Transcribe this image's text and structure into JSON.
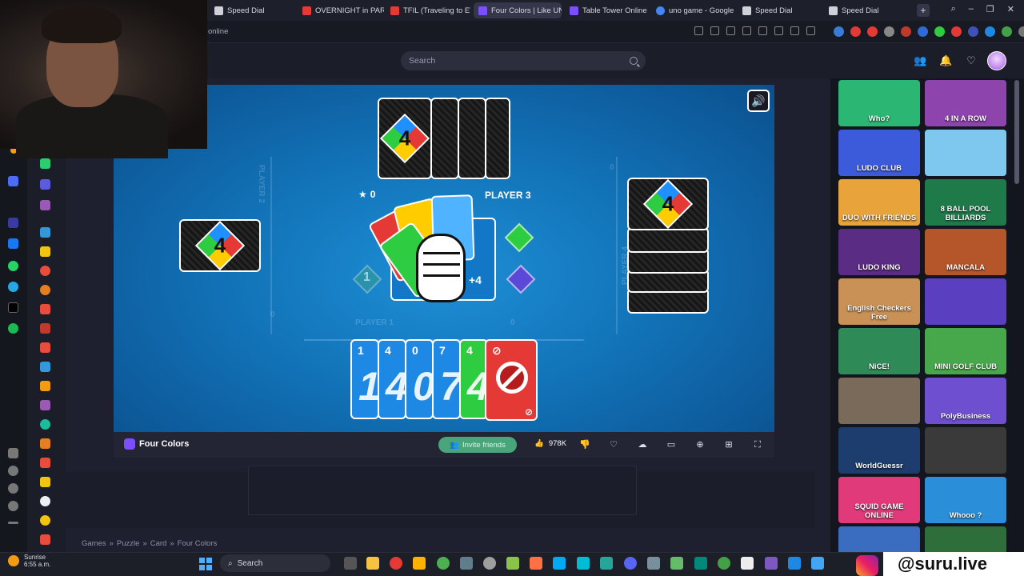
{
  "tabs": [
    {
      "label": "Speed Dial",
      "color": "#d0d0d8"
    },
    {
      "label": "OVERNIGHT in PARIS CA",
      "color": "#e53935"
    },
    {
      "label": "TFIL (Traveling to EVERY",
      "color": "#e53935"
    },
    {
      "label": "Four Colors | Like UNO",
      "color": "#7b4fff"
    },
    {
      "label": "Table Tower Online",
      "color": "#7b4fff"
    },
    {
      "label": "uno game - Google Sear",
      "color": "#4285f4"
    },
    {
      "label": "Speed Dial",
      "color": "#d0d0d8"
    },
    {
      "label": "Speed Dial",
      "color": "#d0d0d8"
    }
  ],
  "address": {
    "url_fragment": "online"
  },
  "site": {
    "search_placeholder": "Search"
  },
  "game": {
    "title": "Four Colors",
    "players": {
      "p1": {
        "label": "PLAYER 1",
        "score": "0"
      },
      "p2": {
        "label": "PLAYER 2",
        "score": "0"
      },
      "p3": {
        "label": "PLAYER 3",
        "score": "0"
      },
      "p4": {
        "label": "PLAYER 4",
        "score": "0"
      }
    },
    "top_cards_count": 5,
    "right_cards_count": 6,
    "hand": [
      {
        "value": "1",
        "color": "#1e88e5"
      },
      {
        "value": "4",
        "color": "#1e88e5"
      },
      {
        "value": "0",
        "color": "#1e88e5"
      },
      {
        "value": "7",
        "color": "#1e88e5"
      },
      {
        "value": "4",
        "color": "#2ecc40"
      },
      {
        "value": "⊘",
        "color": "#e53935"
      }
    ],
    "pile_top": "+4",
    "left_gem": "1"
  },
  "gamebar": {
    "invite_label": "Invite friends",
    "likes": "978K"
  },
  "breadcrumb": [
    "Games",
    "»",
    "Puzzle",
    "»",
    "Card",
    "»",
    "Four Colors"
  ],
  "thumbnails": [
    {
      "label": "Who?",
      "bg": "#2bb673"
    },
    {
      "label": "4 IN A ROW",
      "bg": "#8e44ad"
    },
    {
      "label": "LUDO CLUB",
      "bg": "#3b5bdb"
    },
    {
      "label": "",
      "bg": "#7ec8f0"
    },
    {
      "label": "DUO WITH FRIENDS",
      "bg": "#e8a33a"
    },
    {
      "label": "8 BALL POOL BILLIARDS",
      "bg": "#1f7a4a"
    },
    {
      "label": "LUDO KING",
      "bg": "#5b2c83"
    },
    {
      "label": "MANCALA",
      "bg": "#b5562a"
    },
    {
      "label": "English Checkers Free",
      "bg": "#c99155"
    },
    {
      "label": "",
      "bg": "#5a3fc0"
    },
    {
      "label": "NiCE!",
      "bg": "#2e8b57"
    },
    {
      "label": "MINI GOLF CLUB",
      "bg": "#46a84a"
    },
    {
      "label": "",
      "bg": "#7a6a5a"
    },
    {
      "label": "PolyBusiness",
      "bg": "#6e4fd0"
    },
    {
      "label": "WorldGuessr",
      "bg": "#1c3d6e"
    },
    {
      "label": "",
      "bg": "#3a3a3a"
    },
    {
      "label": "SQUID GAME ONLINE",
      "bg": "#e03a7a"
    },
    {
      "label": "Whooo ?",
      "bg": "#2a8fd8"
    },
    {
      "label": "",
      "bg": "#3a6cc0"
    },
    {
      "label": "",
      "bg": "#2d6e3a"
    }
  ],
  "taskbar": {
    "weather_city": "Sunrise",
    "weather_time": "6:55 a.m.",
    "search_label": "Search",
    "handle": "@suru.live"
  }
}
